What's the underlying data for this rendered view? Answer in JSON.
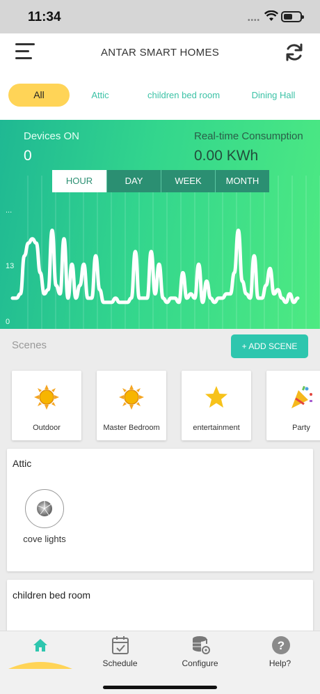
{
  "status_bar": {
    "time": "11:34",
    "dots": "••••"
  },
  "header": {
    "title": "ANTAR SMART HOMES"
  },
  "tabs": [
    {
      "label": "All",
      "active": true
    },
    {
      "label": "Attic"
    },
    {
      "label": "children bed room"
    },
    {
      "label": "Dining Hall"
    }
  ],
  "stats": {
    "devices_on_label": "Devices ON",
    "devices_on_value": "0",
    "consumption_label": "Real-time Consumption",
    "consumption_value": "0.00 KWh"
  },
  "range_tabs": [
    "HOUR",
    "DAY",
    "WEEK",
    "MONTH"
  ],
  "chart_data": {
    "type": "line",
    "y_ticks": [
      "...",
      "13",
      "0"
    ],
    "ylim": [
      0,
      26
    ],
    "values": [
      2,
      2,
      3,
      12,
      15,
      16,
      15,
      8,
      3,
      4,
      18,
      5,
      3,
      16,
      2,
      10,
      2,
      5,
      10,
      2,
      2,
      12,
      4,
      1,
      1,
      1,
      2,
      1,
      1,
      1,
      2,
      13,
      2,
      2,
      2,
      13,
      3,
      10,
      2,
      1,
      2,
      2,
      1,
      8,
      2,
      3,
      2,
      10,
      1,
      6,
      2,
      1,
      2,
      2,
      3,
      3,
      8,
      18,
      6,
      3,
      2,
      12,
      2,
      2,
      5,
      9,
      3,
      4,
      2,
      1,
      3,
      1,
      2
    ]
  },
  "scenes": {
    "title": "Scenes",
    "add_button": "+ ADD SCENE",
    "items": [
      {
        "label": "Outdoor",
        "icon": "sun-icon"
      },
      {
        "label": "Master Bedroom",
        "icon": "sun-icon"
      },
      {
        "label": "entertainment",
        "icon": "star-icon"
      },
      {
        "label": "Party",
        "icon": "party-popper-icon"
      }
    ]
  },
  "rooms": [
    {
      "name": "Attic",
      "devices": [
        {
          "label": "cove lights"
        }
      ]
    },
    {
      "name": "children bed room"
    }
  ],
  "bottom_nav": [
    {
      "label": "",
      "icon": "home-icon"
    },
    {
      "label": "Schedule",
      "icon": "calendar-icon"
    },
    {
      "label": "Configure",
      "icon": "database-gear-icon"
    },
    {
      "label": "Help?",
      "icon": "help-icon"
    }
  ],
  "colors": {
    "accent": "#2ec6ae",
    "tab_active": "#ffd457",
    "gradient_start": "#1fb893",
    "gradient_end": "#4eea82"
  }
}
